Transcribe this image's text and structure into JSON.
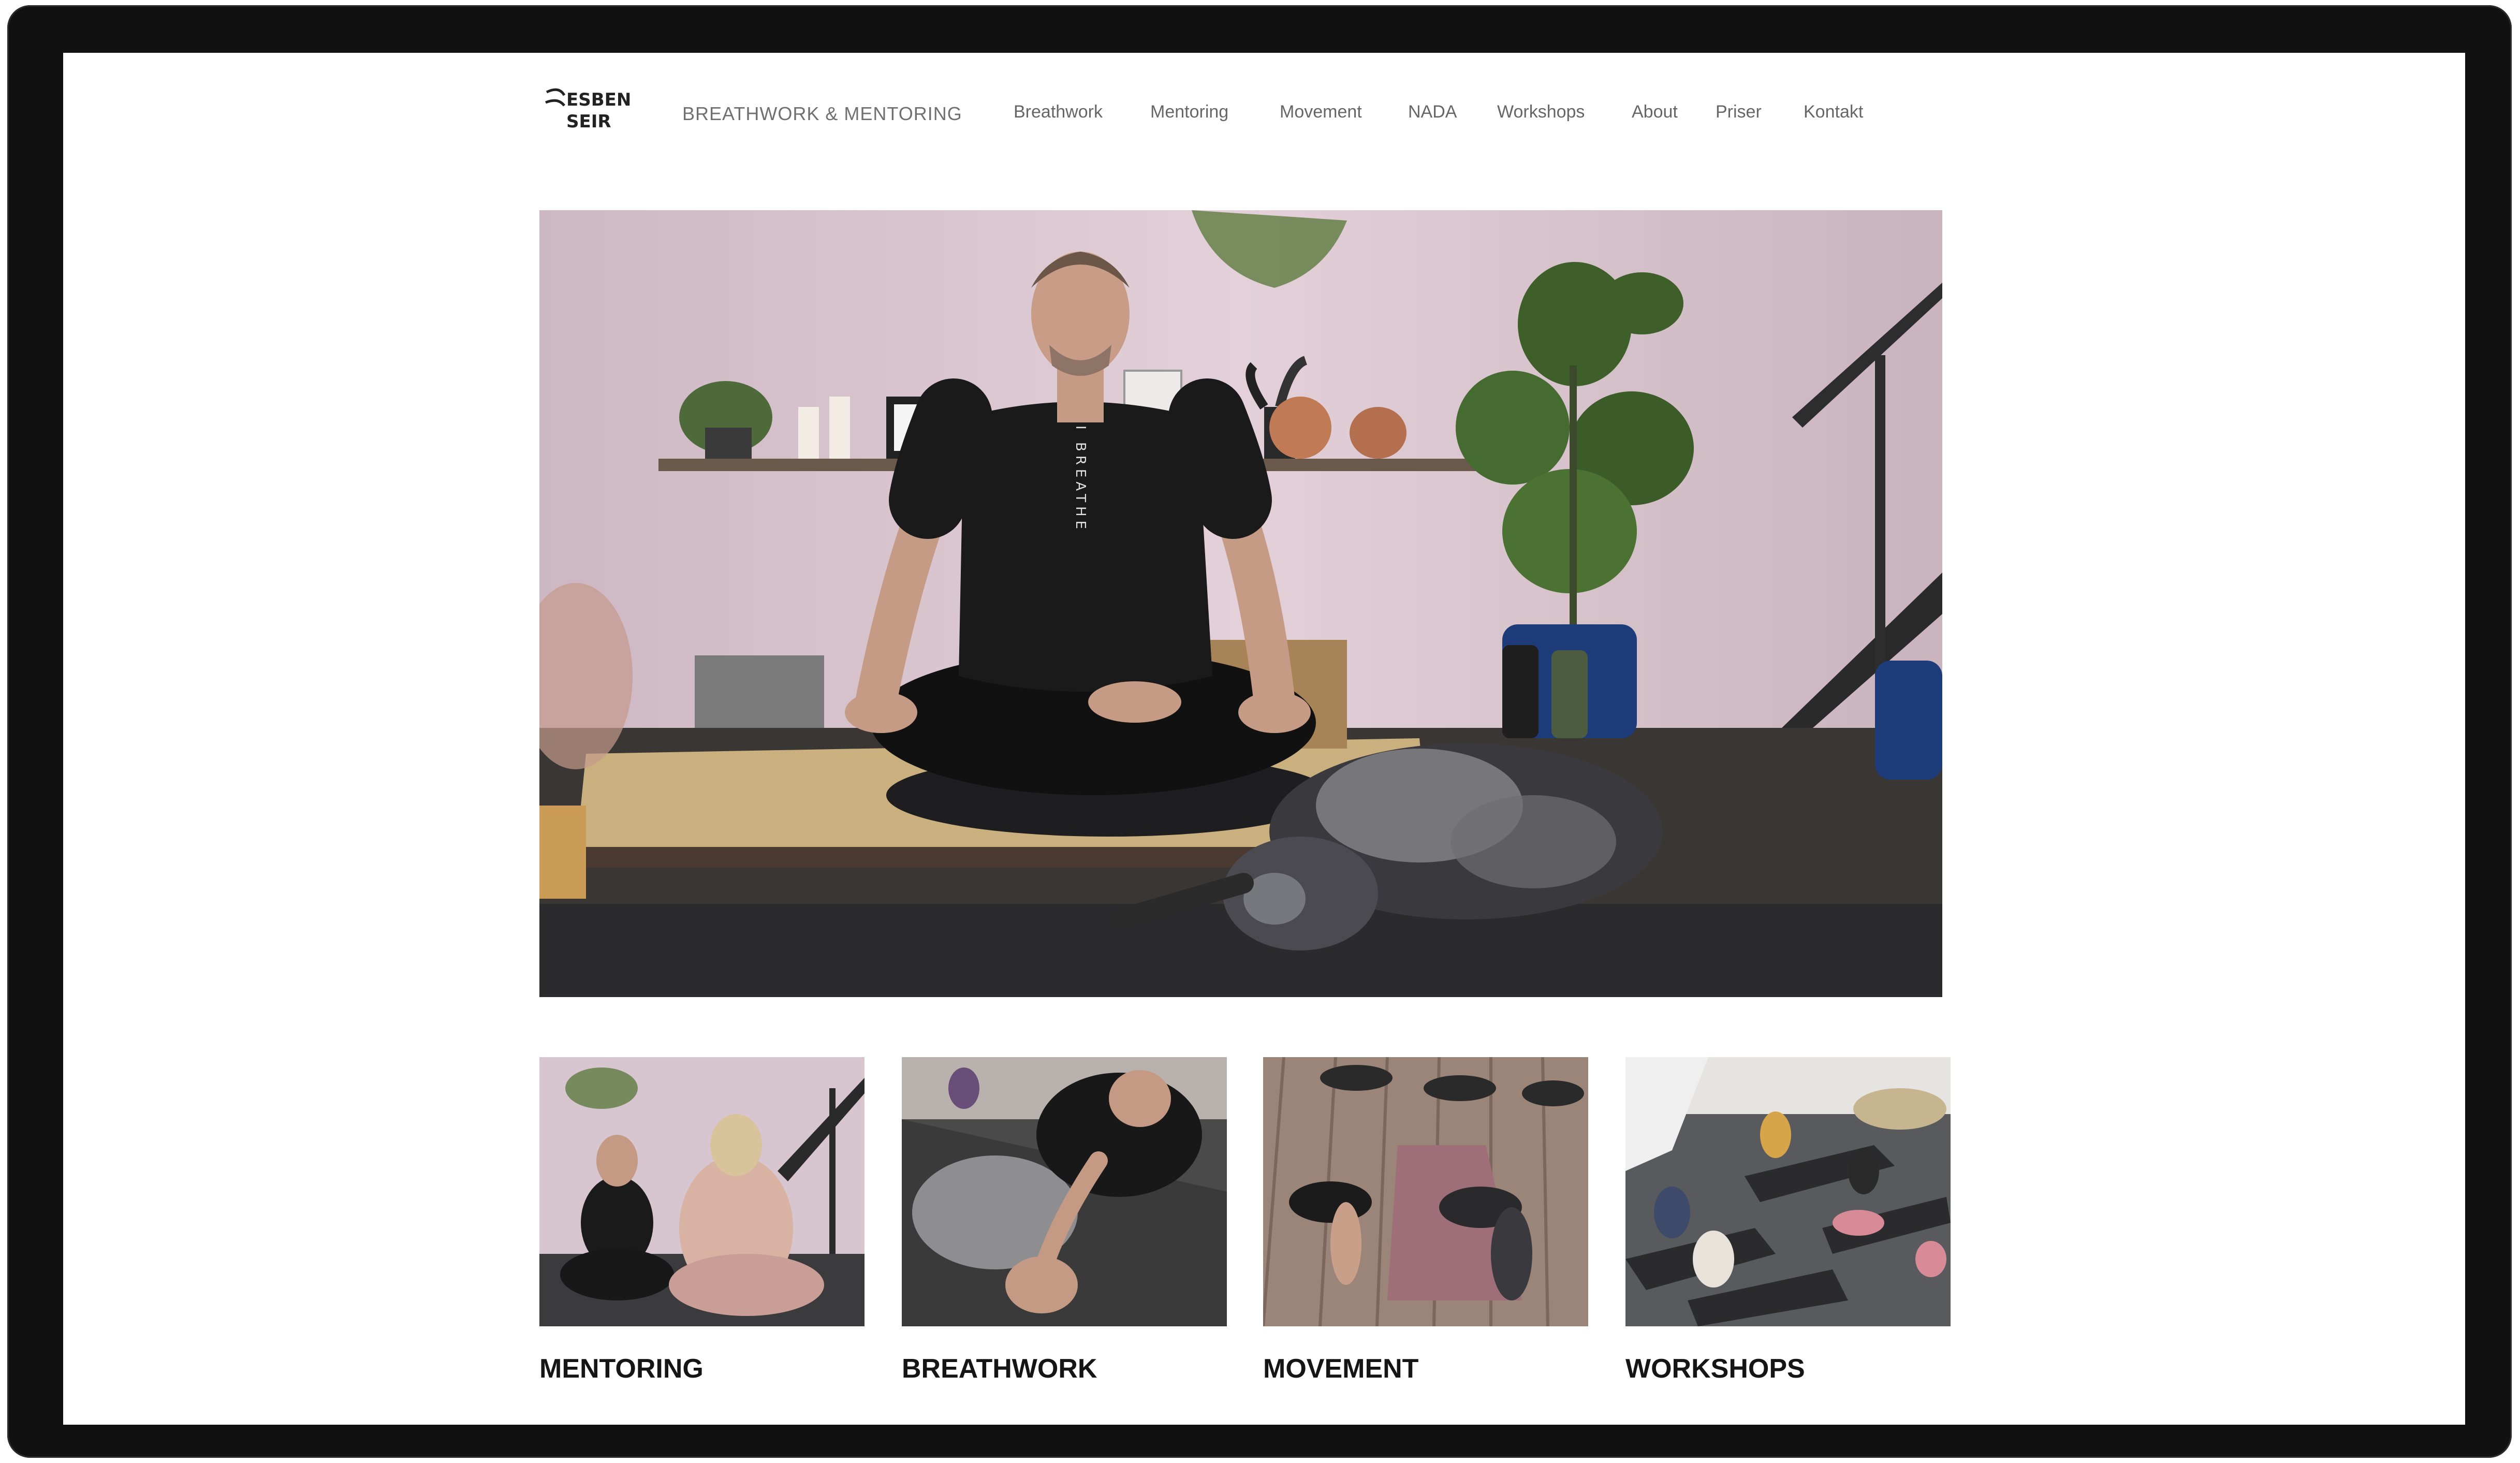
{
  "site": {
    "logo_text_top": "ESBEN",
    "logo_text_bottom": "SEIR",
    "tagline": "BREATHWORK & MENTORING"
  },
  "nav": {
    "items": [
      {
        "label": "Breathwork"
      },
      {
        "label": "Mentoring"
      },
      {
        "label": "Movement"
      },
      {
        "label": "NADA"
      },
      {
        "label": "Workshops"
      },
      {
        "label": "About"
      },
      {
        "label": "Priser"
      },
      {
        "label": "Kontakt"
      }
    ]
  },
  "hero": {
    "shirt_text": "I BREATHE"
  },
  "cards": [
    {
      "label": "MENTORING"
    },
    {
      "label": "BREATHWORK"
    },
    {
      "label": "MOVEMENT"
    },
    {
      "label": "WORKSHOPS"
    }
  ],
  "colors": {
    "monitor_bezel": "#111111",
    "wall_pink": "#d9c4cc",
    "text_dark": "#151515",
    "nav_gray": "#666666"
  }
}
